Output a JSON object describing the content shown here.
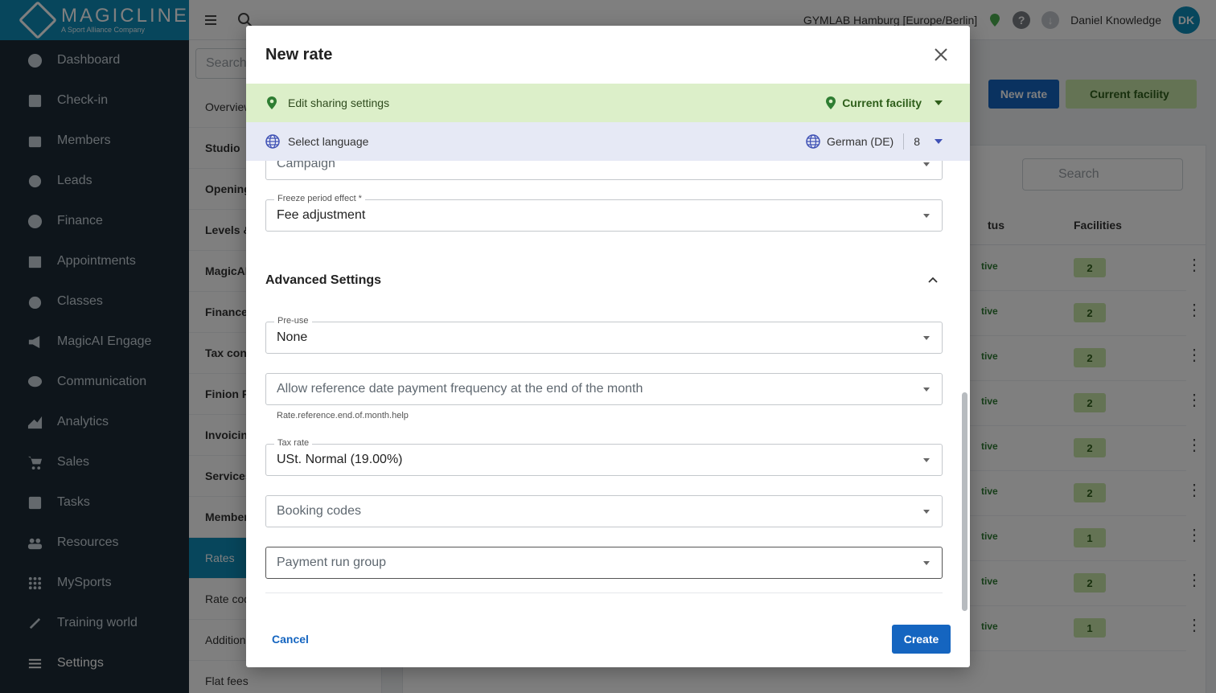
{
  "brand": {
    "name": "MAGICLINE",
    "tagline": "A Sport Alliance Company"
  },
  "sidebar": {
    "items": [
      {
        "label": "Dashboard"
      },
      {
        "label": "Check-in"
      },
      {
        "label": "Members"
      },
      {
        "label": "Leads"
      },
      {
        "label": "Finance"
      },
      {
        "label": "Appointments"
      },
      {
        "label": "Classes"
      },
      {
        "label": "MagicAI Engage"
      },
      {
        "label": "Communication"
      },
      {
        "label": "Analytics"
      },
      {
        "label": "Sales"
      },
      {
        "label": "Tasks"
      },
      {
        "label": "Resources"
      },
      {
        "label": "MySports"
      },
      {
        "label": "Training world"
      },
      {
        "label": "Settings"
      }
    ]
  },
  "topbar": {
    "facility": "GYMLAB Hamburg [Europe/Berlin]",
    "user_name": "Daniel Knowledge",
    "avatar_initials": "DK"
  },
  "settings_menu": {
    "search_placeholder": "Search",
    "items": [
      {
        "label": "Overview"
      },
      {
        "label": "Studio"
      },
      {
        "label": "Opening"
      },
      {
        "label": "Levels &"
      },
      {
        "label": "MagicAI"
      },
      {
        "label": "Finance"
      },
      {
        "label": "Tax conf"
      },
      {
        "label": "Finion Fi"
      },
      {
        "label": "Invoicing"
      },
      {
        "label": "Services"
      },
      {
        "label": "Member"
      },
      {
        "label": "Rates"
      },
      {
        "label": "Rate cod"
      },
      {
        "label": "Addition"
      },
      {
        "label": "Flat fees"
      }
    ]
  },
  "background_page": {
    "new_rate_label": "New rate",
    "facility_filter_label": "Current facility",
    "search_placeholder": "Search",
    "columns": {
      "status": "tus",
      "facilities": "Facilities"
    },
    "rows": [
      {
        "status": "tive",
        "facilities": "2"
      },
      {
        "status": "tive",
        "facilities": "2"
      },
      {
        "status": "tive",
        "facilities": "2"
      },
      {
        "status": "tive",
        "facilities": "2"
      },
      {
        "status": "tive",
        "facilities": "2"
      },
      {
        "status": "tive",
        "facilities": "2"
      },
      {
        "status": "tive",
        "facilities": "1"
      },
      {
        "status": "tive",
        "facilities": "2"
      },
      {
        "status": "tive",
        "facilities": "1"
      }
    ]
  },
  "modal": {
    "title": "New rate",
    "sharing": {
      "label": "Edit sharing settings",
      "value": "Current facility"
    },
    "language": {
      "label": "Select language",
      "value": "German (DE)",
      "count": "8"
    },
    "fields": {
      "campaign": {
        "placeholder": "Campaign"
      },
      "freeze_effect": {
        "label": "Freeze period effect *",
        "value": "Fee adjustment"
      },
      "advanced_title": "Advanced Settings",
      "pre_use": {
        "label": "Pre-use",
        "value": "None"
      },
      "reference_date": {
        "placeholder": "Allow reference date payment frequency at the end of the month",
        "helper": "Rate.reference.end.of.month.help"
      },
      "tax_rate": {
        "label": "Tax rate",
        "value": "USt. Normal (19.00%)"
      },
      "booking_codes": {
        "placeholder": "Booking codes"
      },
      "payment_run_group": {
        "placeholder": "Payment run group"
      }
    },
    "footer": {
      "cancel": "Cancel",
      "create": "Create"
    }
  },
  "colors": {
    "brand": "#0f8cb8",
    "primary": "#1565c0",
    "sidebar_bg": "#1c2b36",
    "share_bar": "#dcefc9",
    "lang_bar": "#e6e9f5"
  }
}
